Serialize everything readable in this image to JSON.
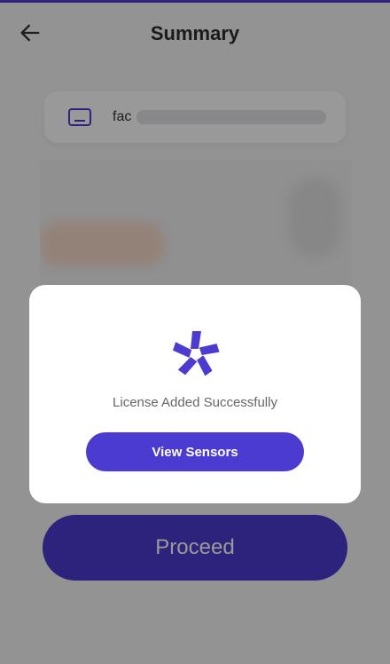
{
  "header": {
    "title": "Summary",
    "back_icon": "arrow-left-icon"
  },
  "license_field": {
    "icon": "license-card-icon",
    "value_prefix": "fac"
  },
  "buttons": {
    "proceed_label": "Proceed"
  },
  "dialog": {
    "icon": "brand-logo-icon",
    "message": "License Added Successfully",
    "button_label": "View Sensors"
  },
  "colors": {
    "accent": "#4b3bd1",
    "overlay": "#00000066"
  }
}
